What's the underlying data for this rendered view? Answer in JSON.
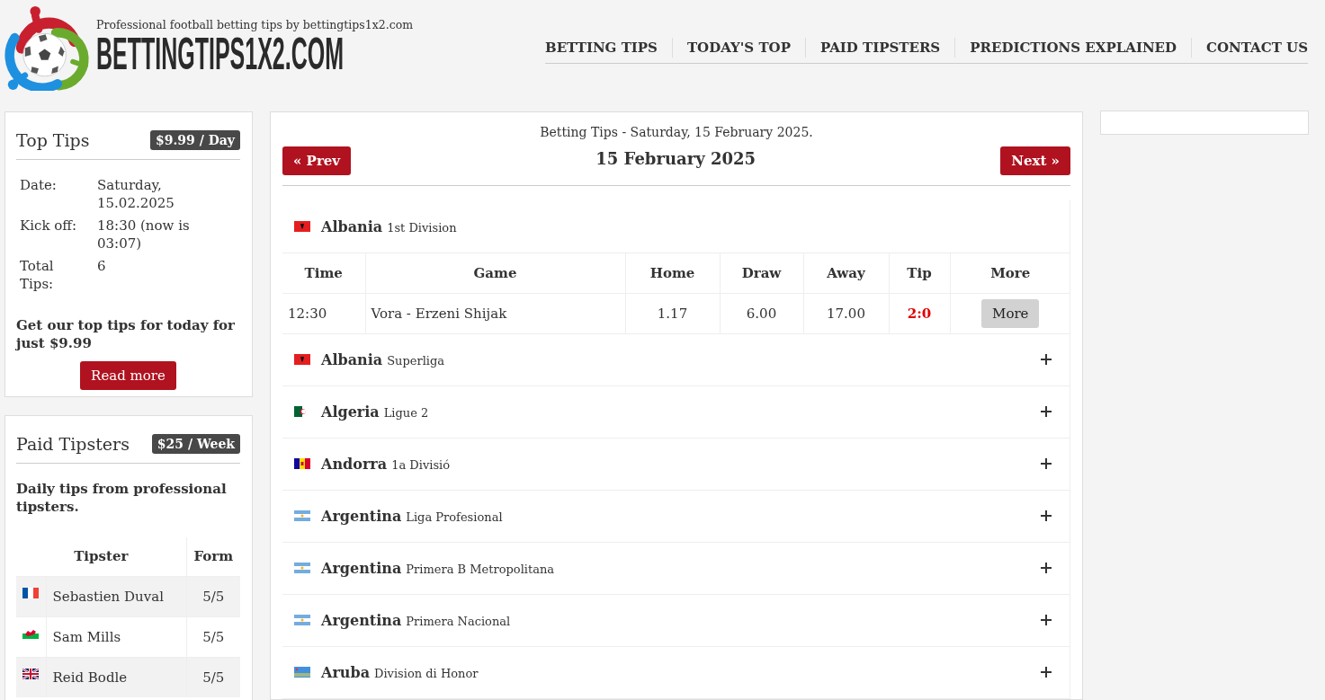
{
  "header": {
    "tagline": "Professional football betting tips by bettingtips1x2.com",
    "wordmark": "BETTINGTIPS1X2.COM"
  },
  "nav": [
    "BETTING TIPS",
    "TODAY'S TOP",
    "PAID TIPSTERS",
    "PREDICTIONS EXPLAINED",
    "CONTACT US"
  ],
  "top_tips": {
    "title": "Top Tips",
    "badge": "$9.99 / Day",
    "details": [
      {
        "label": "Date:",
        "value": "Saturday, 15.02.2025"
      },
      {
        "label": "Kick off:",
        "value": "18:30 (now is 03:07)"
      },
      {
        "label": "Total Tips:",
        "value": "6"
      }
    ],
    "promo": "Get our top tips for today for just $9.99",
    "button": "Read more"
  },
  "paid_tipsters": {
    "title": "Paid Tipsters",
    "badge": "$25 / Week",
    "intro": "Daily tips from professional tipsters.",
    "columns": [
      "Tipster",
      "Form"
    ],
    "rows": [
      {
        "kind": "france",
        "name": "Sebastien Duval",
        "form": "5/5"
      },
      {
        "kind": "wales",
        "name": "Sam Mills",
        "form": "5/5"
      },
      {
        "kind": "uk",
        "name": "Reid Bodle",
        "form": "5/5"
      }
    ]
  },
  "betting_tips": {
    "heading": "Betting Tips - Saturday, 15 February 2025.",
    "date": "15 February 2025",
    "prev": "« Prev",
    "next": "Next »",
    "leagues": [
      {
        "country": "Albania",
        "league": "1st Division",
        "kind": "albania",
        "expanded": true,
        "columns": [
          "Time",
          "Game",
          "Home",
          "Draw",
          "Away",
          "Tip",
          "More"
        ],
        "matches": [
          {
            "time": "12:30",
            "game": "Vora - Erzeni Shijak",
            "home": "1.17",
            "draw": "6.00",
            "away": "17.00",
            "tip": "2:0",
            "button": "More"
          }
        ]
      },
      {
        "country": "Albania",
        "league": "Superliga",
        "kind": "albania",
        "expanded": false
      },
      {
        "country": "Algeria",
        "league": "Ligue 2",
        "kind": "algeria",
        "expanded": false
      },
      {
        "country": "Andorra",
        "league": "1a Divisió",
        "kind": "andorra",
        "expanded": false
      },
      {
        "country": "Argentina",
        "league": "Liga Profesional",
        "kind": "argentina",
        "expanded": false
      },
      {
        "country": "Argentina",
        "league": "Primera B Metropolitana",
        "kind": "argentina",
        "expanded": false
      },
      {
        "country": "Argentina",
        "league": "Primera Nacional",
        "kind": "argentina",
        "expanded": false
      },
      {
        "country": "Aruba",
        "league": "Division di Honor",
        "kind": "aruba",
        "expanded": false
      }
    ]
  }
}
